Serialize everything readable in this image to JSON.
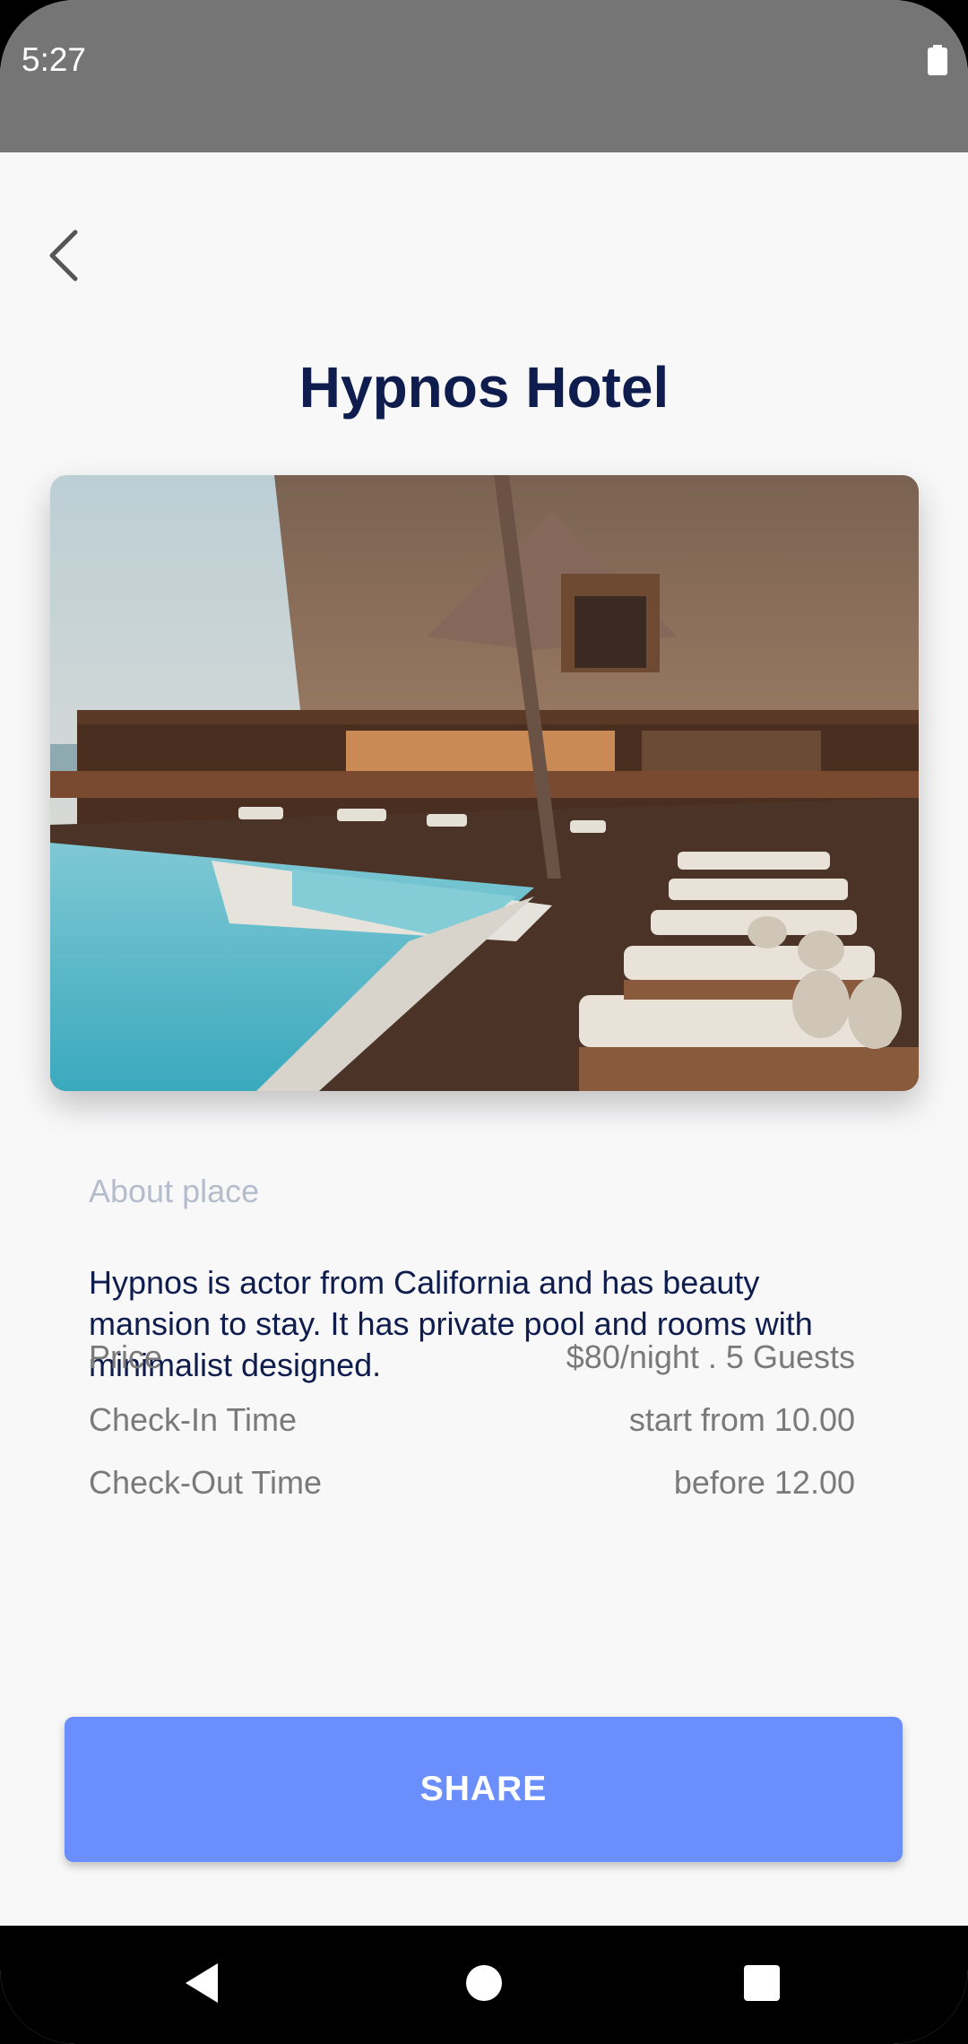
{
  "status_bar": {
    "time": "5:27",
    "battery_icon": "battery-full-icon"
  },
  "header": {
    "back_icon": "chevron-left-icon",
    "title": "Hypnos Hotel"
  },
  "hero": {
    "image_subject": "resort with wooden lodge, pool and sun loungers"
  },
  "about": {
    "label": "About place",
    "description": "Hypnos is actor from California and has beauty mansion to stay. It has private pool and rooms with minimalist designed."
  },
  "details": [
    {
      "label": "Price",
      "value": "$80/night . 5 Guests"
    },
    {
      "label": "Check-In Time",
      "value": "start from 10.00"
    },
    {
      "label": "Check-Out Time",
      "value": "before 12.00"
    }
  ],
  "actions": {
    "share_label": "SHARE"
  },
  "nav_bar": {
    "back_icon": "nav-back-icon",
    "home_icon": "nav-home-icon",
    "recents_icon": "nav-recents-icon"
  },
  "colors": {
    "status_bar": "#757575",
    "background": "#f8f8f9",
    "title": "#0e1d4d",
    "muted_label": "#b5bdcc",
    "detail_text": "#7a7a7a",
    "accent": "#6a8ffd"
  }
}
